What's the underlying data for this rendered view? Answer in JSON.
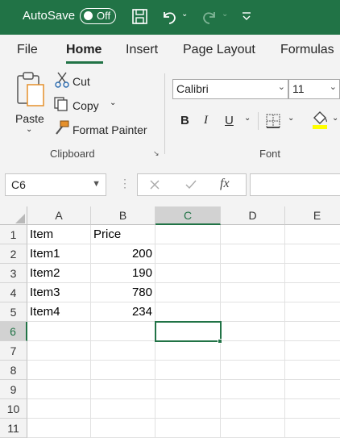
{
  "titlebar": {
    "autosave_label": "AutoSave",
    "autosave_state": "Off"
  },
  "tabs": [
    {
      "label": "File"
    },
    {
      "label": "Home"
    },
    {
      "label": "Insert"
    },
    {
      "label": "Page Layout"
    },
    {
      "label": "Formulas"
    }
  ],
  "clipboard": {
    "paste_label": "Paste",
    "cut_label": "Cut",
    "copy_label": "Copy",
    "format_painter_label": "Format Painter",
    "group_label": "Clipboard"
  },
  "font": {
    "name": "Calibri",
    "size": "11",
    "group_label": "Font",
    "bold": "B",
    "italic": "I",
    "underline": "U"
  },
  "formula_bar": {
    "name_box": "C6",
    "fx": "fx",
    "formula": ""
  },
  "sheet": {
    "columns": [
      "A",
      "B",
      "C",
      "D",
      "E"
    ],
    "selected_column": "C",
    "rows": [
      "1",
      "2",
      "3",
      "4",
      "5",
      "6",
      "7",
      "8",
      "9",
      "10",
      "11"
    ],
    "selected_row": "6",
    "cells": {
      "A1": "Item",
      "B1": "Price",
      "A2": "Item1",
      "B2": "200",
      "A3": "Item2",
      "B3": "190",
      "A4": "Item3",
      "B4": "780",
      "A5": "Item4",
      "B5": "234"
    },
    "active_cell": "C6"
  },
  "colors": {
    "accent": "#217346",
    "highlight_yellow": "#ffff00"
  }
}
